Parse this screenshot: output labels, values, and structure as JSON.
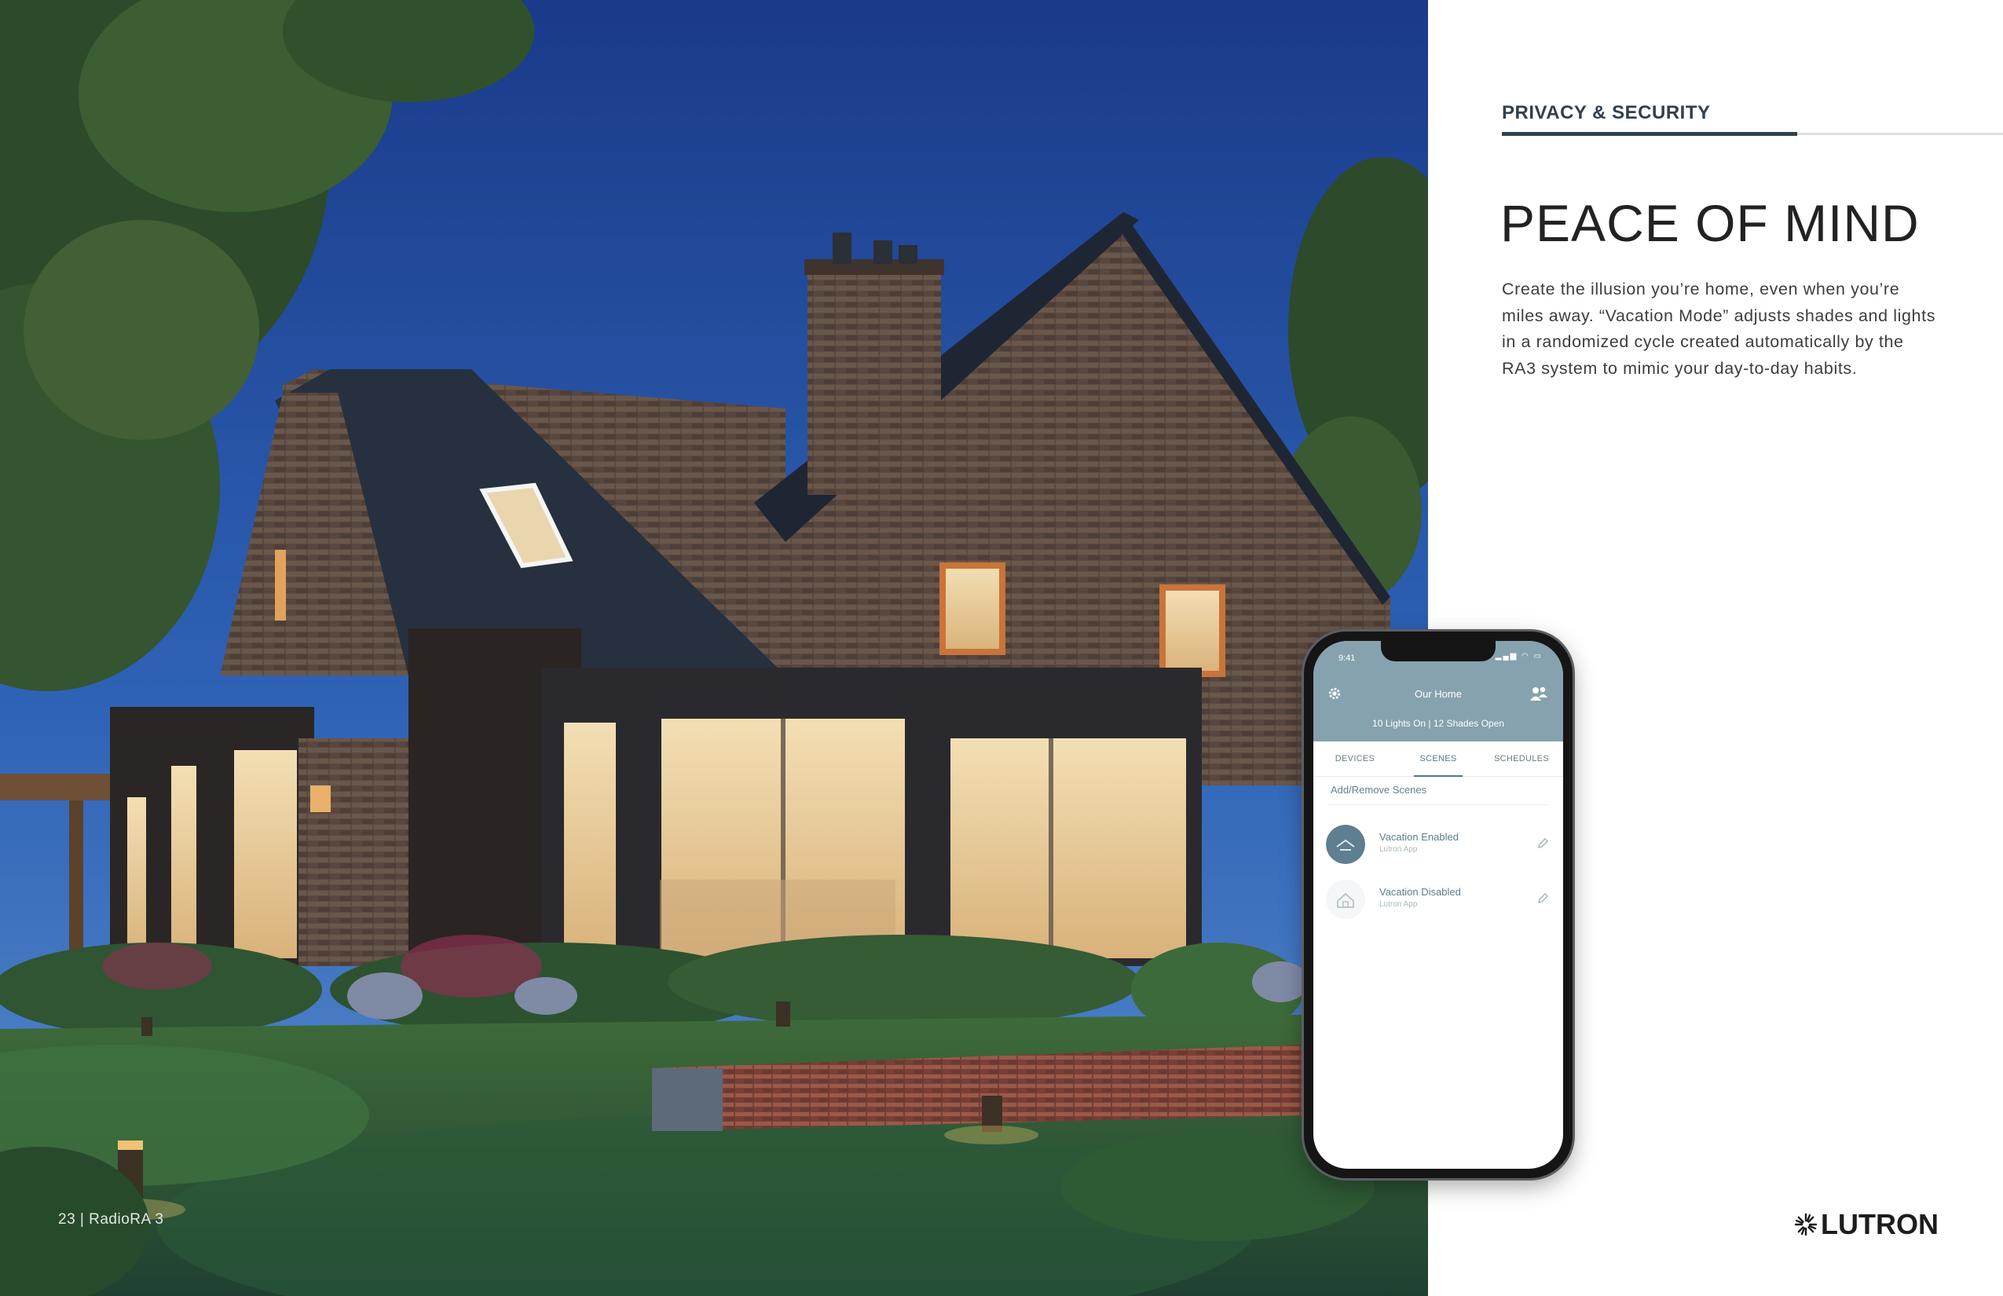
{
  "footer": {
    "page": "23 | RadioRA 3"
  },
  "panel": {
    "section_label": "PRIVACY & SECURITY",
    "headline": "PEACE OF MIND",
    "body": "Create the illusion you’re home, even when you’re miles away. “Vacation Mode” adjusts shades and lights in a randomized cycle created automatically by the RA3 system to mimic your day-to-day habits.",
    "logo_text": "LUTRON"
  },
  "phone": {
    "status_time": "9:41",
    "status_icons": "▂▄▆ ◠ ▭",
    "title": "Our Home",
    "summary": "10 Lights On  |  12 Shades Open",
    "tabs": [
      {
        "label": "DEVICES"
      },
      {
        "label": "SCENES"
      },
      {
        "label": "SCHEDULES"
      }
    ],
    "add_scenes": "Add/Remove Scenes",
    "scenes": [
      {
        "name": "Vacation Enabled",
        "source": "Lutron App",
        "icon": "vacation-enabled-icon"
      },
      {
        "name": "Vacation Disabled",
        "source": "Lutron App",
        "icon": "vacation-disabled-icon"
      }
    ]
  },
  "colors": {
    "accent_dark": "#33404d",
    "app_header": "#86a2ae",
    "app_text": "#5d7d8c"
  }
}
